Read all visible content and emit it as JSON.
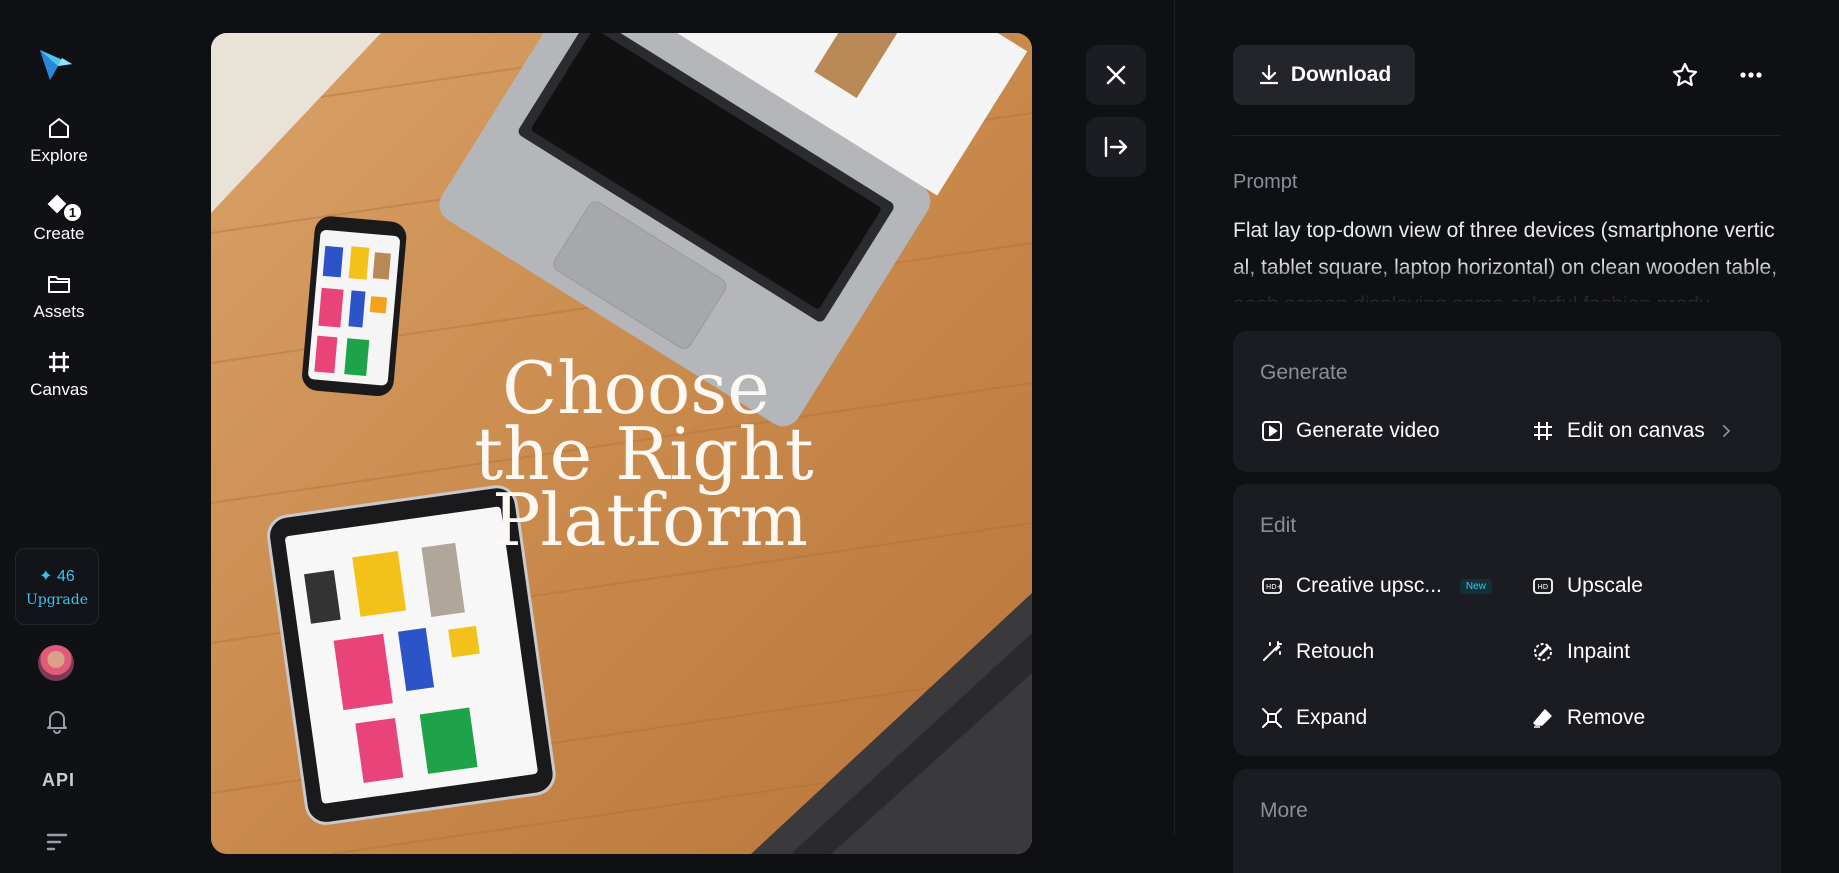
{
  "sidebar": {
    "items": [
      {
        "label": "Explore",
        "icon": "home-icon"
      },
      {
        "label": "Create",
        "icon": "create-icon",
        "badge": "1"
      },
      {
        "label": "Assets",
        "icon": "folder-icon"
      },
      {
        "label": "Canvas",
        "icon": "canvas-icon"
      }
    ],
    "credits": {
      "count": "✦ 46",
      "upgrade_label": "Upgrade"
    },
    "api_label": "API"
  },
  "image": {
    "headline_lines": [
      "Choose",
      "the Right",
      "Platform"
    ]
  },
  "toolbar": {
    "download_label": "Download"
  },
  "prompt": {
    "label": "Prompt",
    "text": "Flat lay top-down view of three devices (smartphone vertical, tablet square, laptop horizontal) on clean wooden table, each screen displaying same colorful fashion produ"
  },
  "generate": {
    "title": "Generate",
    "actions": [
      {
        "label": "Generate video",
        "icon": "play-icon"
      },
      {
        "label": "Edit on canvas",
        "icon": "canvas-icon"
      }
    ]
  },
  "edit": {
    "title": "Edit",
    "actions": [
      {
        "label": "Creative upsc...",
        "icon": "hd-plus-icon",
        "badge": "New"
      },
      {
        "label": "Upscale",
        "icon": "hd-icon"
      },
      {
        "label": "Retouch",
        "icon": "wand-icon"
      },
      {
        "label": "Inpaint",
        "icon": "inpaint-icon"
      },
      {
        "label": "Expand",
        "icon": "expand-icon"
      },
      {
        "label": "Remove",
        "icon": "eraser-icon"
      }
    ]
  },
  "more": {
    "title": "More"
  },
  "colors": {
    "accent": "#3fc3ea",
    "background": "#0f1014",
    "panel": "#1b1c21"
  }
}
